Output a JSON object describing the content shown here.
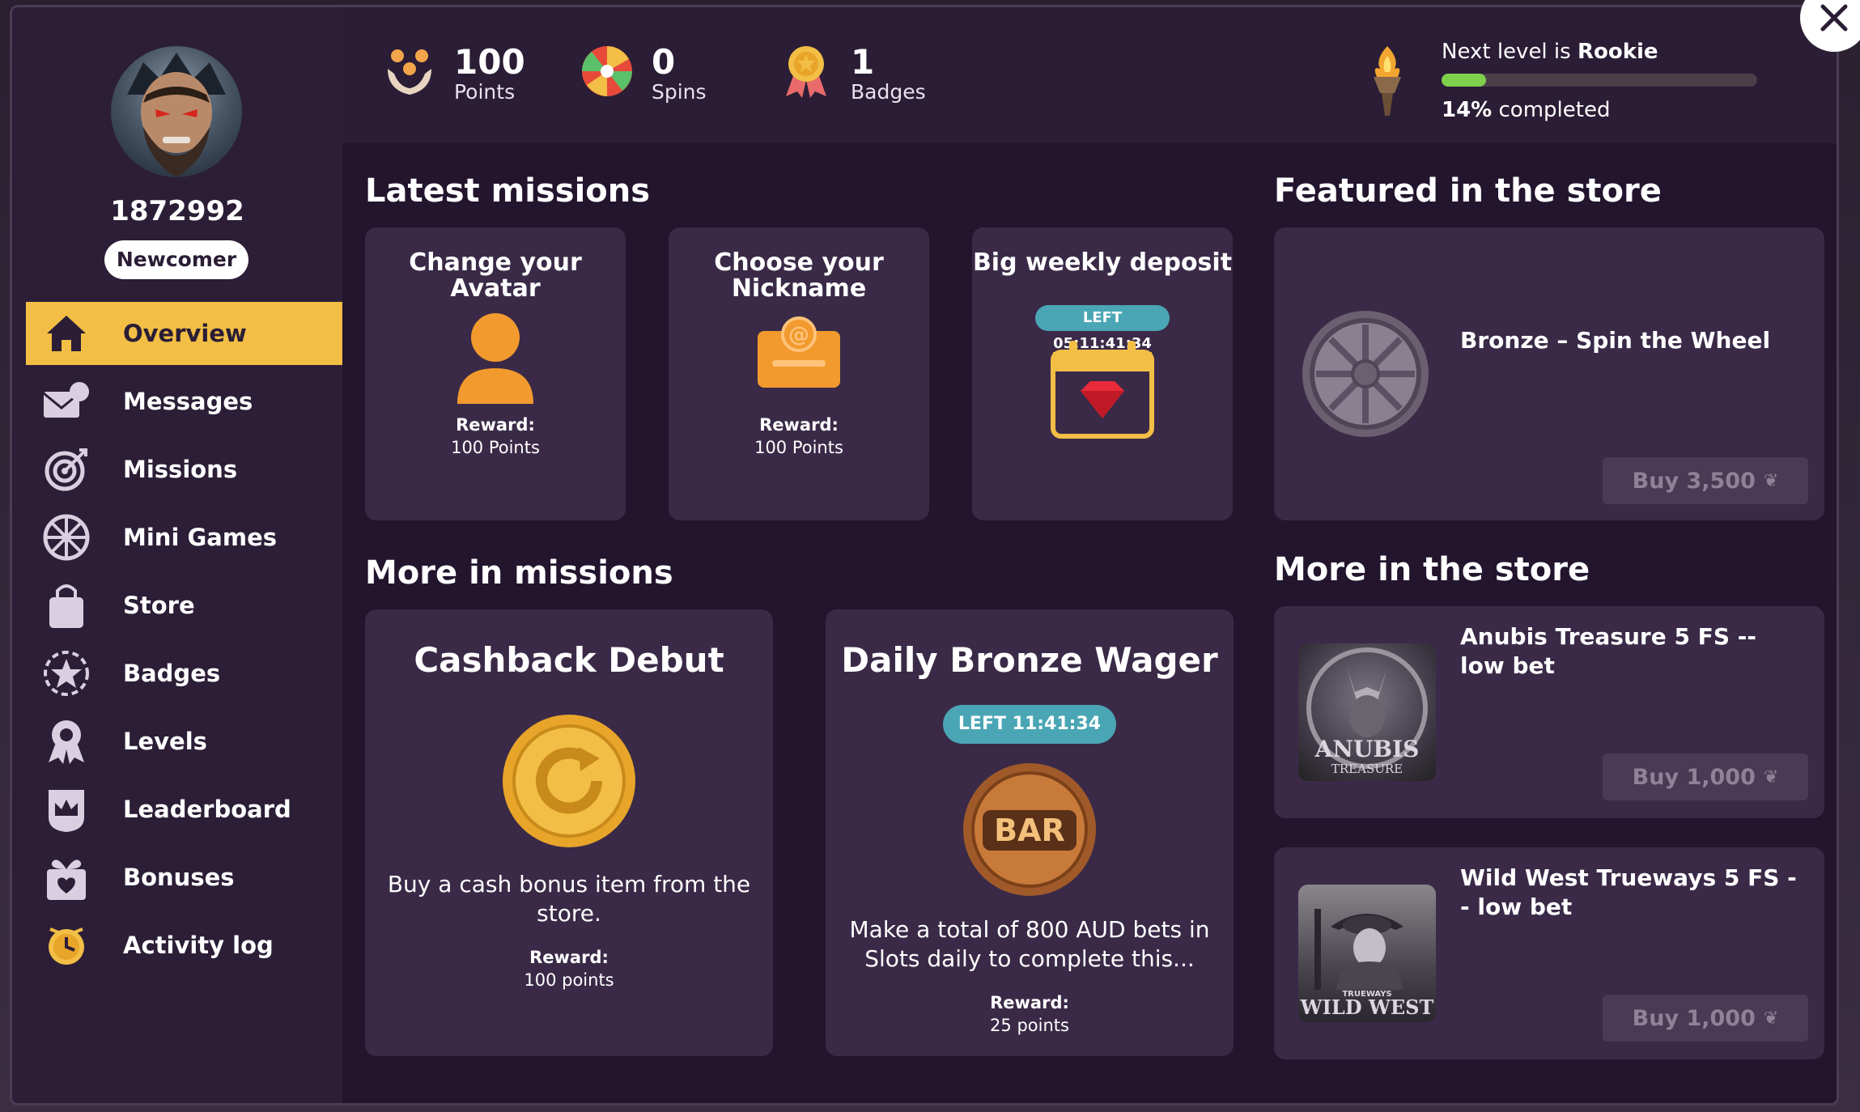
{
  "profile": {
    "user_id": "1872992",
    "rank": "Newcomer"
  },
  "stats": {
    "points_value": "100",
    "points_label": "Points",
    "spins_value": "0",
    "spins_label": "Spins",
    "badges_value": "1",
    "badges_label": "Badges"
  },
  "level": {
    "next_prefix": "Next level is",
    "next_name": "Rookie",
    "percent_text": "14%",
    "completed_label": "completed",
    "progress": 0.14
  },
  "sidebar": {
    "items": [
      {
        "label": "Overview",
        "icon": "home-icon"
      },
      {
        "label": "Messages",
        "icon": "envelope-icon"
      },
      {
        "label": "Missions",
        "icon": "target-icon"
      },
      {
        "label": "Mini Games",
        "icon": "wheel-icon"
      },
      {
        "label": "Store",
        "icon": "shopping-bag-icon"
      },
      {
        "label": "Badges",
        "icon": "star-badge-icon"
      },
      {
        "label": "Levels",
        "icon": "medal-icon"
      },
      {
        "label": "Leaderboard",
        "icon": "crown-icon"
      },
      {
        "label": "Bonuses",
        "icon": "gift-icon"
      },
      {
        "label": "Activity log",
        "icon": "clock-icon"
      }
    ]
  },
  "latest_missions": {
    "title": "Latest missions",
    "cards": [
      {
        "title": "Change your Avatar",
        "reward_label": "Reward:",
        "reward": "100 Points"
      },
      {
        "title": "Choose your Nickname",
        "reward_label": "Reward:",
        "reward": "100 Points"
      },
      {
        "title": "Big weekly deposit",
        "timer": "LEFT 05:11:41:34"
      }
    ]
  },
  "featured_store": {
    "title": "Featured in the store",
    "item_name": "Bronze – Spin the Wheel",
    "buy_label": "Buy 3,500"
  },
  "more_missions": {
    "title": "More in missions",
    "cards": [
      {
        "title": "Cashback Debut",
        "description": "Buy a cash bonus item from the store.",
        "reward_label": "Reward:",
        "reward": "100 points"
      },
      {
        "title": "Daily Bronze Wager",
        "timer": "LEFT 11:41:34",
        "description": "Make a total of 800 AUD bets in Slots daily to complete this...",
        "reward_label": "Reward:",
        "reward": "25 points",
        "icon_text": "BAR"
      }
    ]
  },
  "more_store": {
    "title": "More in the store",
    "items": [
      {
        "name": "Anubis Treasure 5 FS -- low bet",
        "buy_label": "Buy 1,000",
        "thumb_text_1": "ANUBIS",
        "thumb_text_2": "TREASURE"
      },
      {
        "name": "Wild West Trueways 5 FS -- low bet",
        "buy_label": "Buy 1,000",
        "thumb_text_1": "TRUEWAYS",
        "thumb_text_2": "WILD WEST"
      }
    ]
  },
  "colors": {
    "accent": "#f2be45",
    "panel_bg": "#2a1d35",
    "card_bg": "#3a2a47",
    "timer": "#4aa6b4",
    "progress": "#7fd14b"
  }
}
